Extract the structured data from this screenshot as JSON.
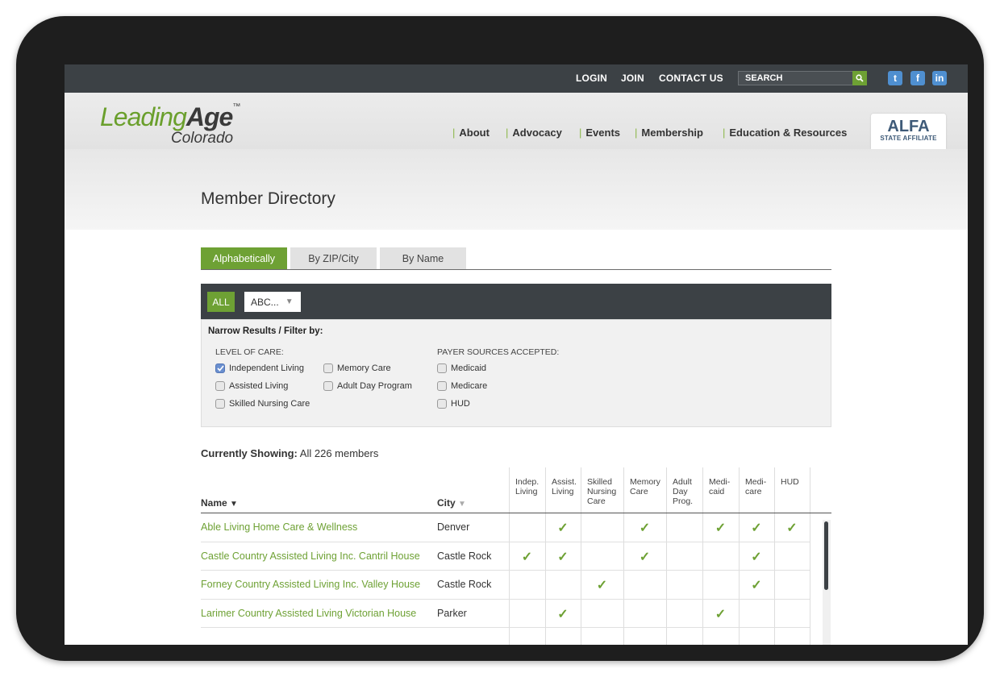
{
  "topbar": {
    "links": [
      "LOGIN",
      "JOIN",
      "CONTACT US"
    ],
    "search_placeholder": "SEARCH",
    "social": [
      {
        "icon": "twitter-icon",
        "glyph": "t"
      },
      {
        "icon": "facebook-icon",
        "glyph": "f"
      },
      {
        "icon": "linkedin-icon",
        "glyph": "in"
      }
    ]
  },
  "logo": {
    "brand_light": "Leading",
    "brand_bold": "Age",
    "tm": "™",
    "sub": "Colorado"
  },
  "nav": [
    "About",
    "Advocacy",
    "Events",
    "Membership",
    "Education & Resources"
  ],
  "alfa": {
    "main": "ALFA",
    "sub": "STATE AFFILIATE"
  },
  "page_title": "Member Directory",
  "tabs": [
    {
      "label": "Alphabetically",
      "active": true
    },
    {
      "label": "By ZIP/City",
      "active": false
    },
    {
      "label": "By Name",
      "active": false
    }
  ],
  "filter": {
    "all_label": "ALL",
    "abc_label": "ABC...",
    "narrow_label": "Narrow Results / Filter by:",
    "level_label": "LEVEL OF CARE:",
    "payer_label": "PAYER SOURCES ACCEPTED:",
    "level_options": [
      {
        "label": "Independent Living",
        "checked": true
      },
      {
        "label": "Memory Care",
        "checked": false
      },
      {
        "label": "Assisted Living",
        "checked": false
      },
      {
        "label": "Adult Day Program",
        "checked": false
      },
      {
        "label": "Skilled Nursing Care",
        "checked": false
      }
    ],
    "payer_options": [
      {
        "label": "Medicaid",
        "checked": false
      },
      {
        "label": "Medicare",
        "checked": false
      },
      {
        "label": "HUD",
        "checked": false
      }
    ]
  },
  "showing": {
    "label": "Currently Showing:",
    "value": "All 226 members"
  },
  "table": {
    "name_header": "Name",
    "city_header": "City",
    "columns": [
      [
        "Indep.",
        "Living"
      ],
      [
        "Assist.",
        "Living"
      ],
      [
        "Skilled",
        "Nursing",
        "Care"
      ],
      [
        "Memory",
        "Care"
      ],
      [
        "Adult",
        "Day",
        "Prog."
      ],
      [
        "Medi-",
        "caid"
      ],
      [
        "Medi-",
        "care"
      ],
      [
        "HUD"
      ]
    ],
    "rows": [
      {
        "name": "Able Living Home Care & Wellness",
        "city": "Denver",
        "checks": [
          false,
          true,
          false,
          true,
          false,
          true,
          true,
          true
        ]
      },
      {
        "name": "Castle Country Assisted Living Inc. Cantril House",
        "city": "Castle Rock",
        "checks": [
          true,
          true,
          false,
          true,
          false,
          false,
          true,
          false
        ]
      },
      {
        "name": "Forney Country Assisted Living Inc. Valley House",
        "city": "Castle Rock",
        "checks": [
          false,
          false,
          true,
          false,
          false,
          false,
          true,
          false
        ]
      },
      {
        "name": "Larimer Country Assisted Living Victorian House",
        "city": "Parker",
        "checks": [
          false,
          true,
          false,
          false,
          false,
          true,
          false,
          false
        ]
      }
    ]
  }
}
